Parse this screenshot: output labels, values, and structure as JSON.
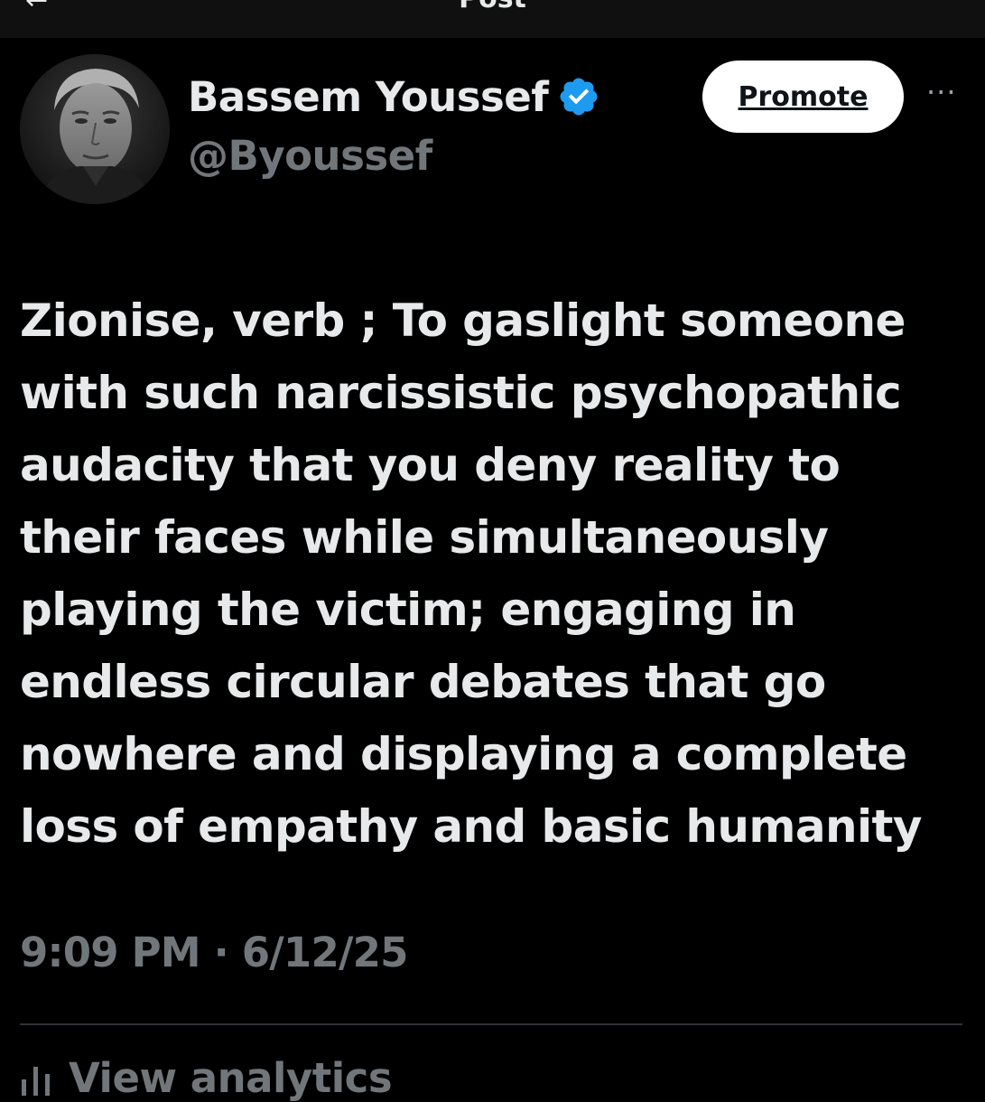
{
  "header": {
    "title": "Post",
    "back_icon": "arrow-left-icon"
  },
  "author": {
    "display_name": "Bassem Youssef",
    "handle": "@Byoussef",
    "verified_icon": "verified-badge-icon",
    "verified_color": "#1d9bf0"
  },
  "actions": {
    "promote_label": "Promote",
    "more_icon": "more-horizontal-icon",
    "more_glyph": "···"
  },
  "post": {
    "text": "Zionise, verb ; To gaslight someone\nwith such narcissistic psychopathic\naudacity that you deny reality to\ntheir faces while simultaneously\nplaying the victim; engaging in\nendless circular debates that go\nnowhere and displaying a complete\nloss of empathy and basic humanity",
    "timestamp": "9:09 PM · 6/12/25"
  },
  "footer": {
    "analytics_label": "View analytics",
    "analytics_icon": "bar-chart-icon"
  },
  "colors": {
    "background": "#000000",
    "text_primary": "#e7e9ea",
    "text_secondary": "#71767b",
    "divider": "#2f3336",
    "promote_bg": "#ffffff"
  }
}
